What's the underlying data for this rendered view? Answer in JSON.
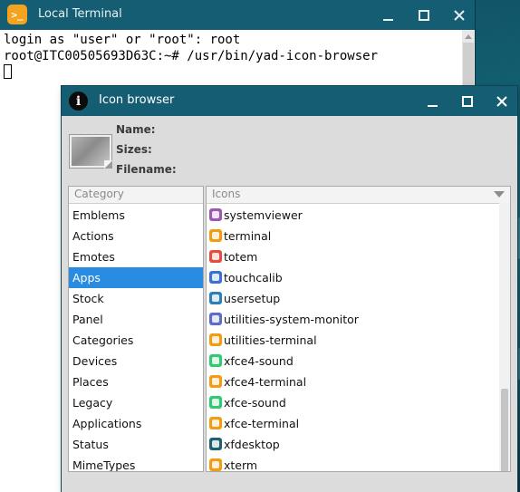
{
  "terminal": {
    "title": "Local Terminal",
    "app_icon_glyph": ">_",
    "lines": [
      "login as \"user\" or \"root\": root",
      "root@ITC00505693D63C:~# /usr/bin/yad-icon-browser"
    ]
  },
  "dialog": {
    "title": "Icon browser",
    "info_icon_glyph": "i",
    "info": {
      "name_label": "Name:",
      "sizes_label": "Sizes:",
      "filename_label": "Filename:"
    },
    "category_header": "Category",
    "icons_header": "Icons",
    "categories": [
      "Emblems",
      "Actions",
      "Emotes",
      "Apps",
      "Stock",
      "Panel",
      "Categories",
      "Devices",
      "Places",
      "Legacy",
      "Applications",
      "Status",
      "MimeTypes"
    ],
    "selected_category": "Apps",
    "icons": [
      {
        "label": "systemviewer",
        "icon": "systemviewer-icon",
        "color": "#9b59b6"
      },
      {
        "label": "terminal",
        "icon": "terminal-icon",
        "color": "#f39c12"
      },
      {
        "label": "totem",
        "icon": "totem-icon",
        "color": "#e74c3c"
      },
      {
        "label": "touchcalib",
        "icon": "touchcalib-icon",
        "color": "#3a6fd8"
      },
      {
        "label": "usersetup",
        "icon": "usersetup-icon",
        "color": "#2c7fb8"
      },
      {
        "label": "utilities-system-monitor",
        "icon": "system-monitor-icon",
        "color": "#5b6bd6"
      },
      {
        "label": "utilities-terminal",
        "icon": "terminal-icon",
        "color": "#f39c12"
      },
      {
        "label": "xfce4-sound",
        "icon": "sound-icon",
        "color": "#2ecc71"
      },
      {
        "label": "xfce4-terminal",
        "icon": "terminal-icon",
        "color": "#f39c12"
      },
      {
        "label": "xfce-sound",
        "icon": "sound-icon",
        "color": "#2ecc71"
      },
      {
        "label": "xfce-terminal",
        "icon": "terminal-icon",
        "color": "#f39c12"
      },
      {
        "label": "xfdesktop",
        "icon": "xfdesktop-icon",
        "color": "#1f5f73"
      },
      {
        "label": "xterm",
        "icon": "terminal-icon",
        "color": "#f39c12"
      }
    ]
  },
  "colors": {
    "titlebar": "#155d73",
    "selection": "#2a8ce0"
  }
}
